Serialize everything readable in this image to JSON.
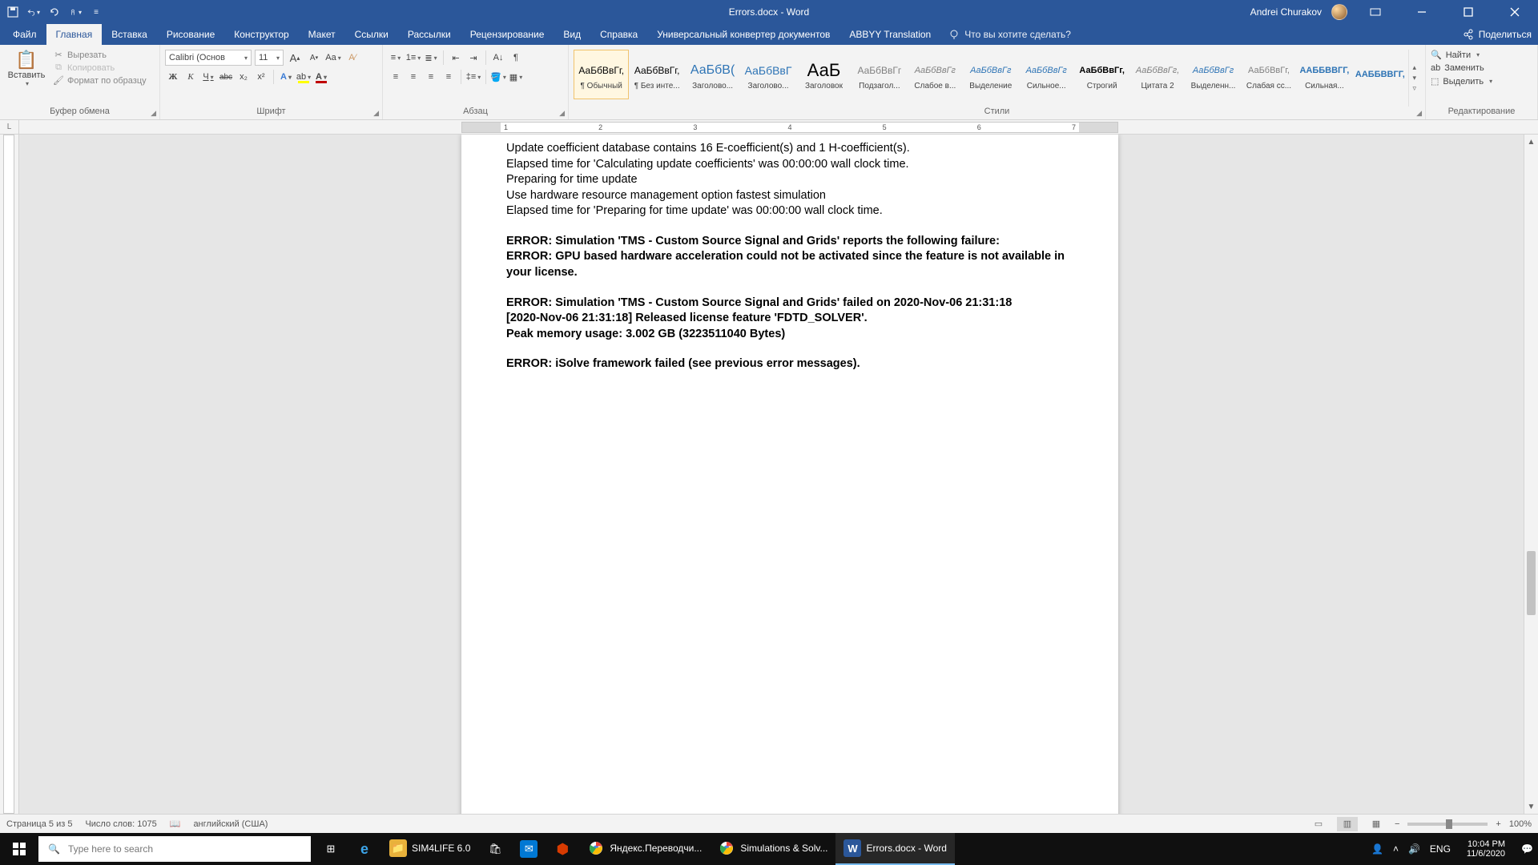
{
  "title_bar": {
    "doc_title": "Errors.docx  -  Word",
    "user_name": "Andrei Churakov"
  },
  "tabs": {
    "file": "Файл",
    "home": "Главная",
    "insert": "Вставка",
    "draw": "Рисование",
    "design": "Конструктор",
    "layout": "Макет",
    "references": "Ссылки",
    "mailings": "Рассылки",
    "review": "Рецензирование",
    "view": "Вид",
    "help": "Справка",
    "udc": "Универсальный конвертер документов",
    "abbyy": "ABBYY Translation",
    "tell_me": "Что вы хотите сделать?",
    "share": "Поделиться"
  },
  "ribbon": {
    "clipboard": {
      "label": "Буфер обмена",
      "paste": "Вставить",
      "cut": "Вырезать",
      "copy": "Копировать",
      "format_painter": "Формат по образцу"
    },
    "font": {
      "label": "Шрифт",
      "name": "Calibri (Основ",
      "size": "11",
      "bold": "Ж",
      "italic": "К",
      "underline": "Ч",
      "strike": "abc",
      "sub": "x₂",
      "sup": "x²"
    },
    "paragraph": {
      "label": "Абзац"
    },
    "styles": {
      "label": "Стили",
      "items": [
        {
          "preview": "АаБбВвГг,",
          "label": "¶ Обычный",
          "color": "#000",
          "bold": false,
          "size": "12px"
        },
        {
          "preview": "АаБбВвГг,",
          "label": "¶ Без инте...",
          "color": "#000",
          "bold": false,
          "size": "12px"
        },
        {
          "preview": "АаБбВ(",
          "label": "Заголово...",
          "color": "#2e74b5",
          "bold": false,
          "size": "16px"
        },
        {
          "preview": "АаБбВвГ",
          "label": "Заголово...",
          "color": "#2e74b5",
          "bold": false,
          "size": "14px"
        },
        {
          "preview": "АаБ",
          "label": "Заголовок",
          "color": "#000",
          "bold": false,
          "size": "22px"
        },
        {
          "preview": "АаБбВвГг",
          "label": "Подзагол...",
          "color": "#808080",
          "bold": false,
          "size": "12px"
        },
        {
          "preview": "АаБбВвГг",
          "label": "Слабое в...",
          "color": "#808080",
          "bold": false,
          "size": "11px",
          "italic": true
        },
        {
          "preview": "АаБбВвГг",
          "label": "Выделение",
          "color": "#2e74b5",
          "bold": false,
          "size": "11px",
          "italic": true
        },
        {
          "preview": "АаБбВвГг",
          "label": "Сильное...",
          "color": "#2e74b5",
          "bold": false,
          "size": "11px",
          "italic": true
        },
        {
          "preview": "АаБбВвГг,",
          "label": "Строгий",
          "color": "#000",
          "bold": true,
          "size": "11px"
        },
        {
          "preview": "АаБбВвГг,",
          "label": "Цитата 2",
          "color": "#808080",
          "bold": false,
          "size": "11px",
          "italic": true
        },
        {
          "preview": "АаБбВвГг",
          "label": "Выделенн...",
          "color": "#2e74b5",
          "bold": false,
          "size": "11px",
          "italic": true
        },
        {
          "preview": "АаБбВвГг,",
          "label": "Слабая сс...",
          "color": "#808080",
          "bold": false,
          "size": "11px"
        },
        {
          "preview": "ААББВВГГ,",
          "label": "Сильная...",
          "color": "#2e74b5",
          "bold": true,
          "size": "11px"
        },
        {
          "preview": "ААББВВГГ,",
          "label": "",
          "color": "#2e74b5",
          "bold": true,
          "size": "11px"
        }
      ]
    },
    "editing": {
      "label": "Редактирование",
      "find": "Найти",
      "replace": "Заменить",
      "select": "Выделить"
    }
  },
  "ruler_numbers": [
    "1",
    "2",
    "3",
    "4",
    "5",
    "6",
    "7"
  ],
  "document": {
    "lines": [
      {
        "text": "Update coefficient database contains 16 E-coefficient(s) and 1 H-coefficient(s).",
        "bold": false
      },
      {
        "text": "Elapsed time for 'Calculating update coefficients' was 00:00:00 wall clock time.",
        "bold": false
      },
      {
        "text": "Preparing for time update",
        "bold": false
      },
      {
        "text": "Use hardware resource management option fastest simulation",
        "bold": false
      },
      {
        "text": "Elapsed time for 'Preparing for time update' was 00:00:00 wall clock time.",
        "bold": false
      },
      {
        "text": "",
        "bold": false,
        "spacer": true
      },
      {
        "text": "ERROR: Simulation 'TMS - Custom Source Signal and Grids' reports the following failure:",
        "bold": true
      },
      {
        "text": "ERROR: GPU based hardware acceleration could not be activated since the feature is not available in your license.",
        "bold": true
      },
      {
        "text": "",
        "bold": false,
        "spacer": true
      },
      {
        "text": "ERROR: Simulation 'TMS - Custom Source Signal and Grids' failed on 2020-Nov-06 21:31:18",
        "bold": true
      },
      {
        "text": "[2020-Nov-06 21:31:18] Released license feature 'FDTD_SOLVER'.",
        "bold": true
      },
      {
        "text": "Peak memory usage: 3.002 GB (3223511040 Bytes)",
        "bold": true
      },
      {
        "text": "",
        "bold": false,
        "spacer": true
      },
      {
        "text": "ERROR: iSolve framework failed (see previous error messages).",
        "bold": true
      }
    ]
  },
  "status": {
    "page": "Страница 5 из 5",
    "words": "Число слов: 1075",
    "lang": "английский (США)",
    "zoom": "100%"
  },
  "taskbar": {
    "search_placeholder": "Type here to search",
    "items": [
      {
        "name": "sim4life",
        "label": "SIM4LIFE 6.0",
        "color": "#e8b13b"
      },
      {
        "name": "store",
        "label": "",
        "color": "#ffffff"
      },
      {
        "name": "mail",
        "label": "",
        "color": "#0078d4"
      },
      {
        "name": "office",
        "label": "",
        "color": "#d83b01"
      },
      {
        "name": "chrome-yandex",
        "label": "Яндекс.Переводчи...",
        "color": "#ffffff"
      },
      {
        "name": "chrome-sim",
        "label": "Simulations & Solv...",
        "color": "#ffffff"
      },
      {
        "name": "word-errors",
        "label": "Errors.docx - Word",
        "color": "#2b579a"
      }
    ],
    "tray": {
      "lang": "ENG",
      "time": "10:04 PM",
      "date": "11/6/2020"
    }
  }
}
